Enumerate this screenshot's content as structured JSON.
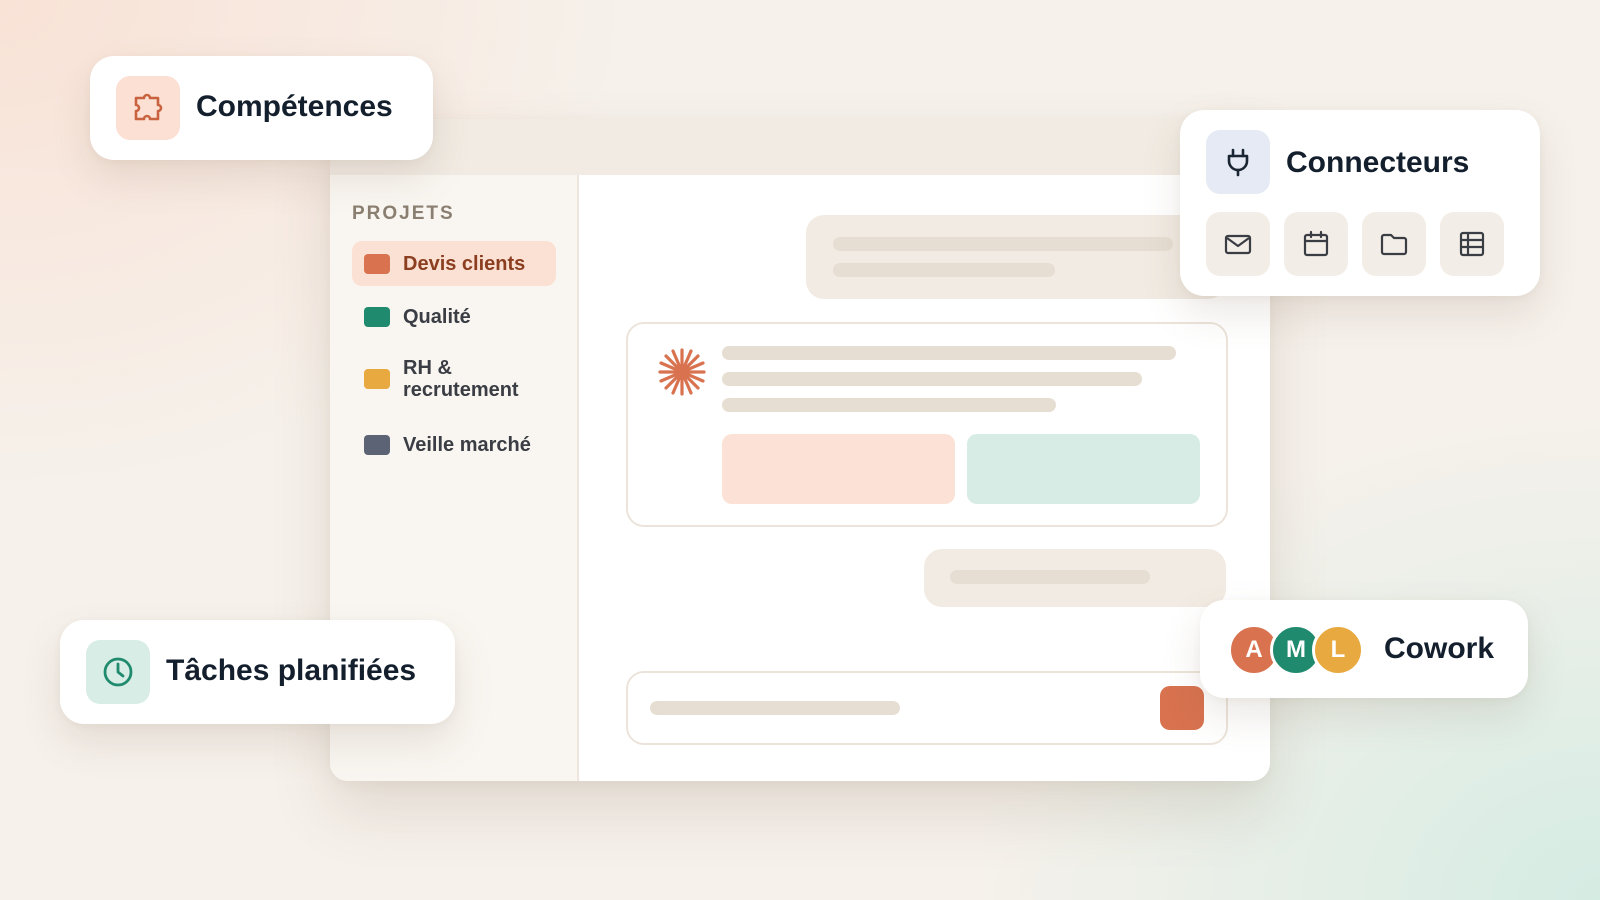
{
  "sidebar": {
    "heading": "PROJETS",
    "projects": [
      {
        "label": "Devis clients",
        "color": "#d8724f",
        "active": true
      },
      {
        "label": "Qualité",
        "color": "#1f8a6e",
        "active": false
      },
      {
        "label": "RH & recrutement",
        "color": "#e8a940",
        "active": false
      },
      {
        "label": "Veille marché",
        "color": "#5b6374",
        "active": false
      }
    ]
  },
  "cards": {
    "competences": {
      "title": "Compétences",
      "icon": "puzzle-icon"
    },
    "taches": {
      "title": "Tâches planifiées",
      "icon": "clock-icon"
    },
    "connecteurs": {
      "title": "Connecteurs",
      "icon": "plug-icon",
      "tools": [
        "mail-icon",
        "calendar-icon",
        "folder-icon",
        "table-icon"
      ]
    },
    "cowork": {
      "title": "Cowork",
      "avatars": [
        {
          "initial": "A",
          "color": "#d8724f"
        },
        {
          "initial": "M",
          "color": "#1f8a6e"
        },
        {
          "initial": "L",
          "color": "#e8a940"
        }
      ]
    }
  },
  "colors": {
    "accent": "#d8724f",
    "green": "#1f8a6e",
    "amber": "#e8a940",
    "slate": "#5b6374"
  }
}
